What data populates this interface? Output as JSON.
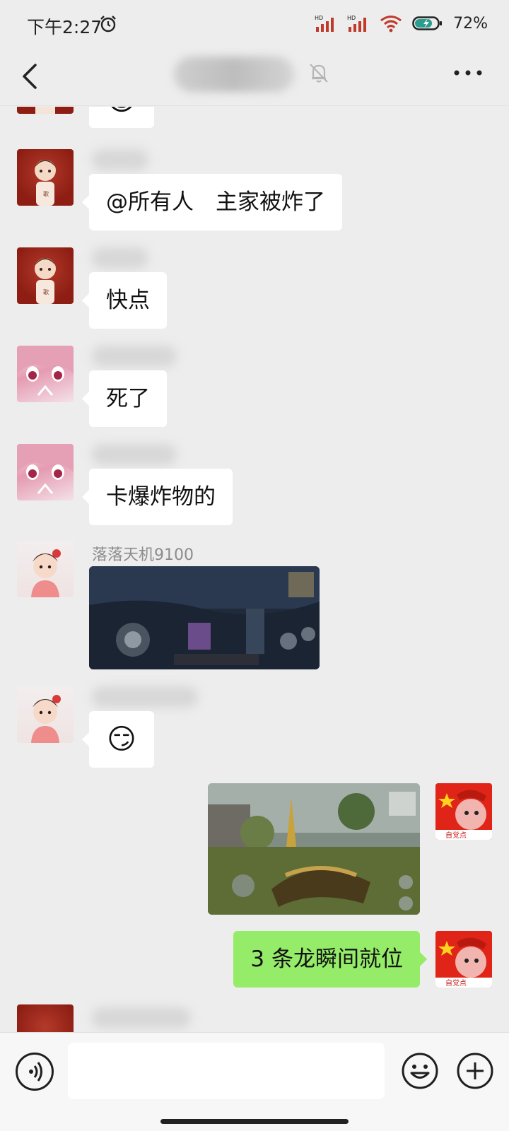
{
  "status_bar": {
    "time": "下午2:27",
    "signal_1_label": "HD",
    "signal_2_label": "HD",
    "battery": "72%",
    "icons": [
      "alarm-icon",
      "signal-icon",
      "wifi-icon",
      "battery-icon"
    ]
  },
  "nav": {
    "back_icon": "chevron-left-icon",
    "title": "",
    "mute_icon": "bell-off-icon",
    "more_icon": "more-horizontal-icon"
  },
  "messages": [
    {
      "side": "in",
      "type": "emoji",
      "emoji": "😁",
      "avatar": "boy-avatar"
    },
    {
      "side": "in",
      "type": "text",
      "text": "@所有人　主家被炸了",
      "avatar": "boy-avatar"
    },
    {
      "side": "in",
      "type": "text",
      "text": "快点",
      "avatar": "boy-avatar"
    },
    {
      "side": "in",
      "type": "text",
      "text": "死了",
      "avatar": "anime-avatar"
    },
    {
      "side": "in",
      "type": "text",
      "text": "卡爆炸物的",
      "avatar": "anime-avatar"
    },
    {
      "side": "in",
      "type": "image",
      "sender": "落落天机9100",
      "image": "game-screenshot-night",
      "avatar": "girl-avatar"
    },
    {
      "side": "in",
      "type": "emoji",
      "emoji": "😏",
      "avatar": "girl-avatar"
    },
    {
      "side": "out",
      "type": "image",
      "image": "game-screenshot-dragons",
      "avatar": "flag-avatar"
    },
    {
      "side": "out",
      "type": "text",
      "text": "3 条龙瞬间就位",
      "avatar": "flag-avatar"
    }
  ],
  "avatar_labels": {
    "boy_badge": "歌",
    "me_caption": "自觉点"
  },
  "input_bar": {
    "voice_icon": "voice-icon",
    "input_value": "",
    "emoji_icon": "emoji-smile-icon",
    "plus_icon": "plus-circle-icon"
  },
  "colors": {
    "background": "#ededed",
    "incoming_bubble": "#ffffff",
    "outgoing_bubble": "#95ec69"
  }
}
